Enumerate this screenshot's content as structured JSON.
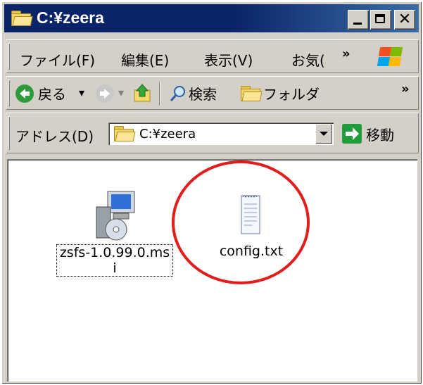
{
  "window": {
    "title": "C:¥zeera",
    "buttons": {
      "close_glyph": "✕"
    }
  },
  "menubar": {
    "items": [
      "ファイル(F)",
      "編集(E)",
      "表示(V)",
      "お気("
    ],
    "overflow": "»"
  },
  "toolbar": {
    "back_label": "戻る",
    "dropdown_glyph": "▾",
    "search_label": "検索",
    "folders_label": "フォルダ",
    "overflow": "»"
  },
  "address_bar": {
    "label": "アドレス(D)",
    "value": "C:¥zeera",
    "go_label": "移動"
  },
  "files": [
    {
      "name": "zsfs-1.0.99.0.msi",
      "icon": "installer-package-icon",
      "selected": true
    },
    {
      "name": "config.txt",
      "icon": "text-file-icon",
      "selected": false
    }
  ],
  "colors": {
    "titlebar": "#0a246a",
    "annotation": "#e21b1b"
  }
}
